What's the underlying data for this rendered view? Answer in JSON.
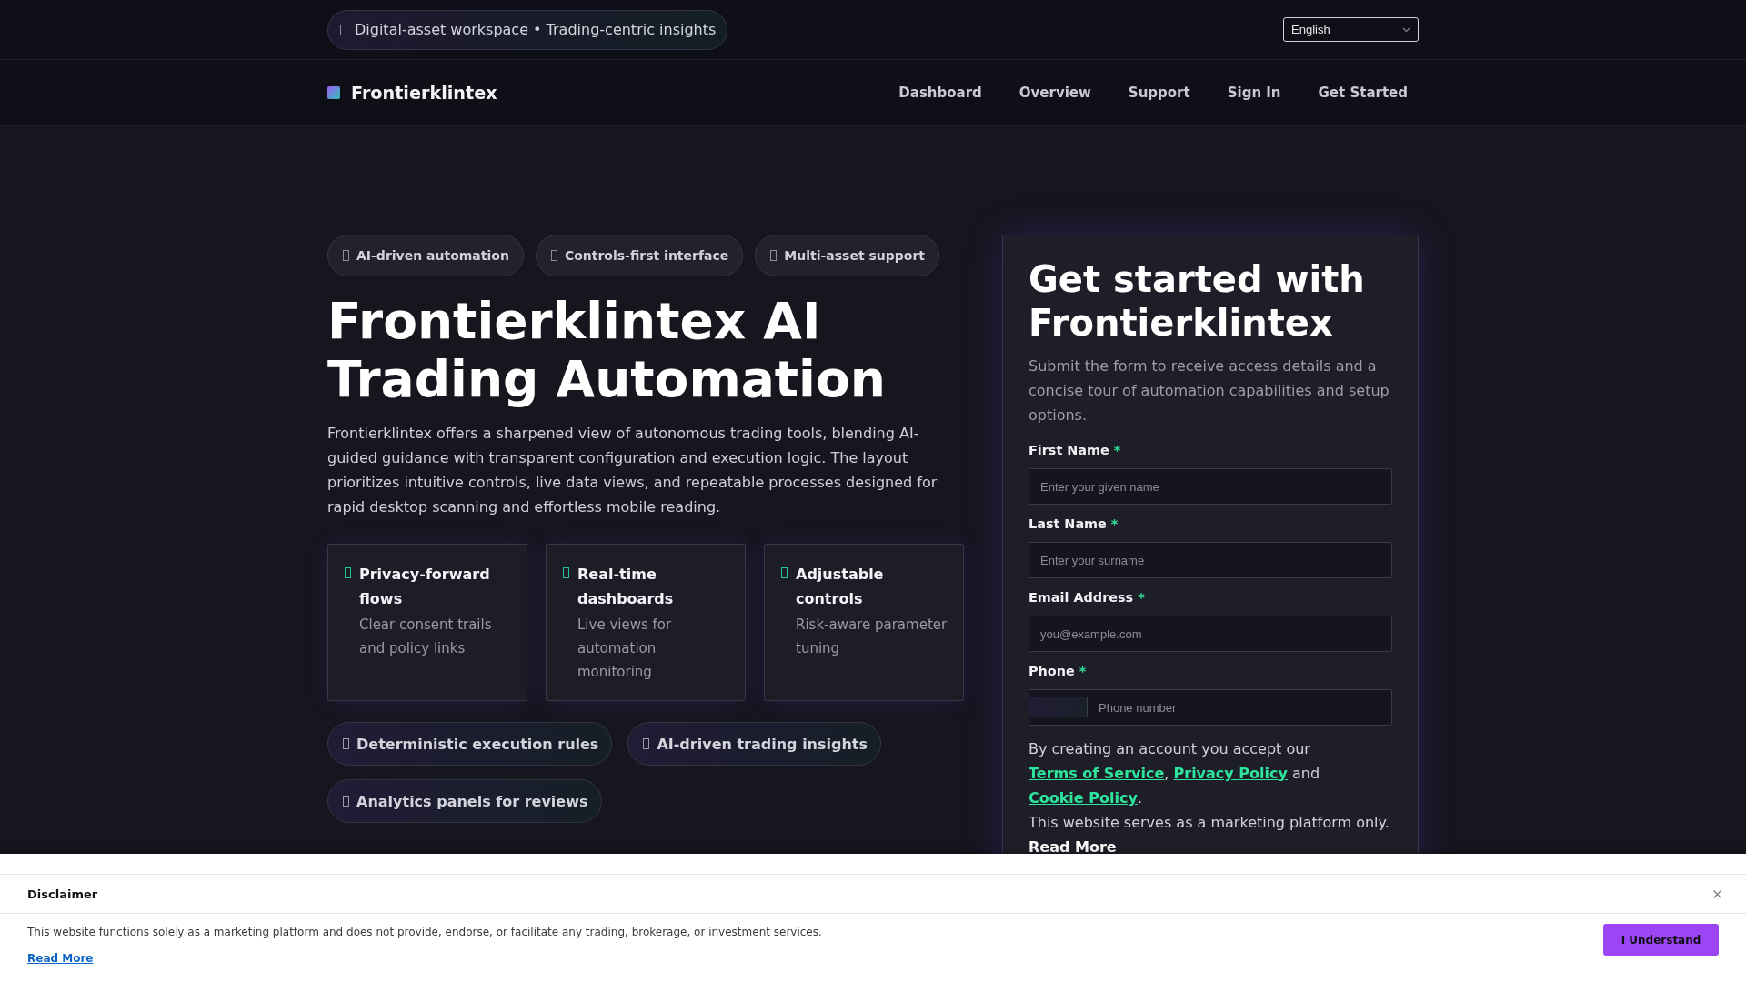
{
  "top_bar": {
    "tagline": "Digital-asset workspace • Trading-centric insights",
    "language": "English"
  },
  "nav": {
    "brand": "Frontierklintex",
    "links": [
      "Dashboard",
      "Overview",
      "Support",
      "Sign In",
      "Get Started"
    ]
  },
  "hero": {
    "tags": [
      "AI-driven automation",
      "Controls-first interface",
      "Multi-asset support"
    ],
    "title": "Frontierklintex AI Trading Automation",
    "description": "Frontierklintex offers a sharpened view of autonomous trading tools, blending AI-guided guidance with transparent configuration and execution logic. The layout prioritizes intuitive controls, live data views, and repeatable processes designed for rapid desktop scanning and effortless mobile reading.",
    "features": [
      {
        "title": "Privacy-forward flows",
        "text": "Clear consent trails and policy links"
      },
      {
        "title": "Real-time dashboards",
        "text": "Live views for automation monitoring"
      },
      {
        "title": "Adjustable controls",
        "text": "Risk-aware parameter tuning"
      }
    ],
    "highlights": [
      "Deterministic execution rules",
      "AI-driven trading insights",
      "Analytics panels for reviews"
    ]
  },
  "signup_form": {
    "title": "Get started with Frontierklintex",
    "subtitle": "Submit the form to receive access details and a concise tour of automation capabilities and setup options.",
    "fields": [
      {
        "kind": "text",
        "label": "First Name",
        "required_mark": "*",
        "placeholder": "Enter your given name"
      },
      {
        "kind": "text",
        "label": "Last Name",
        "required_mark": "*",
        "placeholder": "Enter your surname"
      },
      {
        "kind": "email",
        "label": "Email Address",
        "required_mark": "*",
        "placeholder": "you@example.com"
      },
      {
        "kind": "phone",
        "label": "Phone",
        "required_mark": "*",
        "placeholder": "Phone number"
      }
    ],
    "consent": [
      {
        "kind": "text",
        "text": "By creating an account you accept our "
      },
      {
        "kind": "link",
        "text": "Terms of Service"
      },
      {
        "kind": "text",
        "text": ", "
      },
      {
        "kind": "link",
        "text": "Privacy Policy"
      },
      {
        "kind": "text",
        "text": " and "
      },
      {
        "kind": "link",
        "text": "Cookie Policy"
      },
      {
        "kind": "text",
        "text": "."
      }
    ],
    "notice": {
      "text": "This website serves as a marketing platform only.",
      "link": "Read More"
    }
  },
  "disclaimer": {
    "title": "Disclaimer",
    "text": "This website functions solely as a marketing platform and does not provide, endorse, or facilitate any trading, brokerage, or investment services.",
    "link": "Read More",
    "button": "I Understand"
  }
}
